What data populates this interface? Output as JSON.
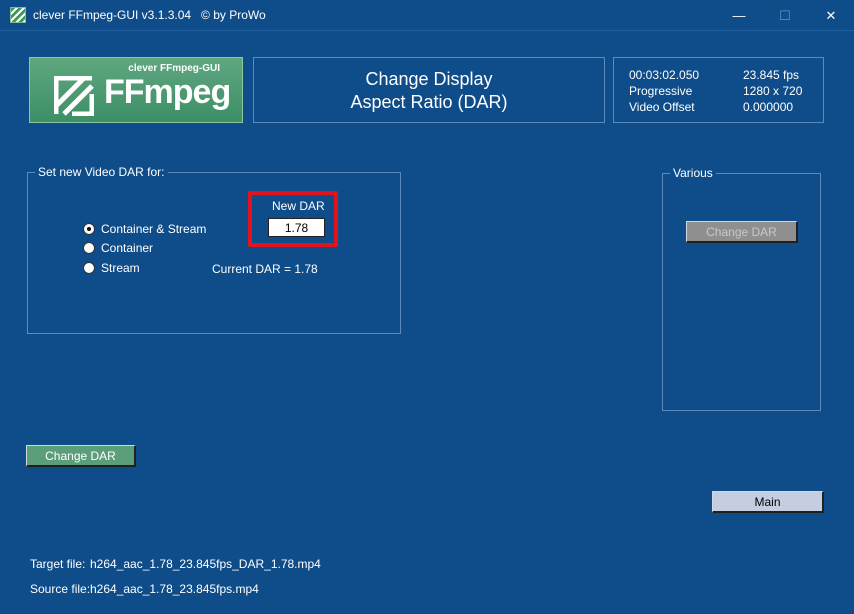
{
  "window": {
    "title": "clever FFmpeg-GUI v3.1.3.04   © by ProWo",
    "minimize": "—",
    "maximize": "☐",
    "close": "✕"
  },
  "logo": {
    "small_text": "clever FFmpeg-GUI",
    "big_text": "FFmpeg"
  },
  "heading": {
    "line1": "Change Display",
    "line2": "Aspect Ratio (DAR)"
  },
  "info": {
    "duration": "00:03:02.050",
    "fps": "23.845 fps",
    "scan": "Progressive",
    "resolution": "1280 x 720",
    "offset_label": "Video Offset",
    "offset_value": "0.000000"
  },
  "dar_group": {
    "legend": "Set new Video DAR for:",
    "options": [
      {
        "label": "Container & Stream",
        "checked": true
      },
      {
        "label": "Container",
        "checked": false
      },
      {
        "label": "Stream",
        "checked": false
      }
    ],
    "new_dar_label": "New DAR",
    "new_dar_value": "1.78",
    "current_dar": "Current DAR = 1.78"
  },
  "various_group": {
    "legend": "Various",
    "button": "Change DAR"
  },
  "buttons": {
    "change_dar": "Change DAR",
    "main": "Main"
  },
  "files": {
    "target_label": "Target file:",
    "target_value": "h264_aac_1.78_23.845fps_DAR_1.78.mp4",
    "source_label": "Source file:",
    "source_value": "h264_aac_1.78_23.845fps.mp4"
  },
  "colors": {
    "background": "#0f4c8a",
    "highlight": "#e0141e",
    "logo_green": "#4c9a72"
  }
}
